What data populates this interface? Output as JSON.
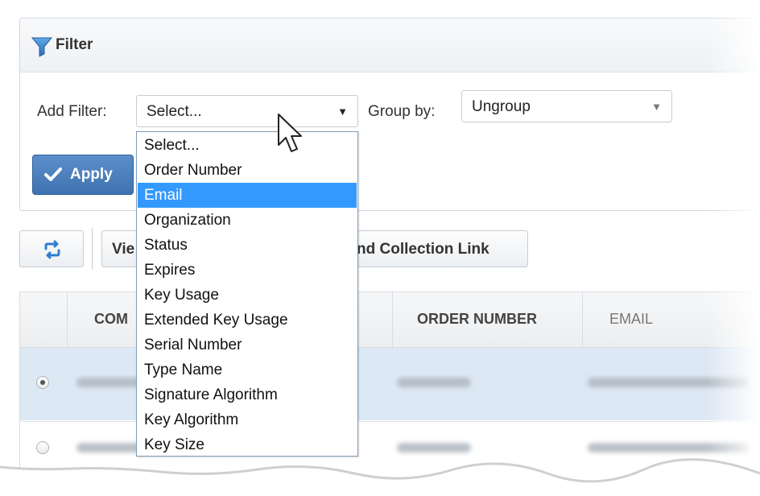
{
  "filter": {
    "title": "Filter",
    "add_filter_label": "Add Filter:",
    "add_filter_value": "Select...",
    "group_by_label": "Group by:",
    "group_by_value": "Ungroup",
    "apply_label": "Apply"
  },
  "dropdown": {
    "selected_index": 2,
    "options": [
      "Select...",
      "Order Number",
      "Email",
      "Organization",
      "Status",
      "Expires",
      "Key Usage",
      "Extended Key Usage",
      "Serial Number",
      "Type Name",
      "Signature Algorithm",
      "Key Algorithm",
      "Key Size"
    ]
  },
  "toolbar": {
    "refresh_icon": "refresh-icon",
    "view_label": "Vie",
    "collection_link_label": "nd Collection Link"
  },
  "table": {
    "headers": [
      "COM",
      "ORDER NUMBER",
      "EMAIL"
    ],
    "rows": [
      {
        "selected": true
      },
      {
        "selected": false
      }
    ]
  },
  "colors": {
    "accent": "#3f72b0",
    "highlight": "#3399ff",
    "selected_row": "#dde8f5"
  }
}
